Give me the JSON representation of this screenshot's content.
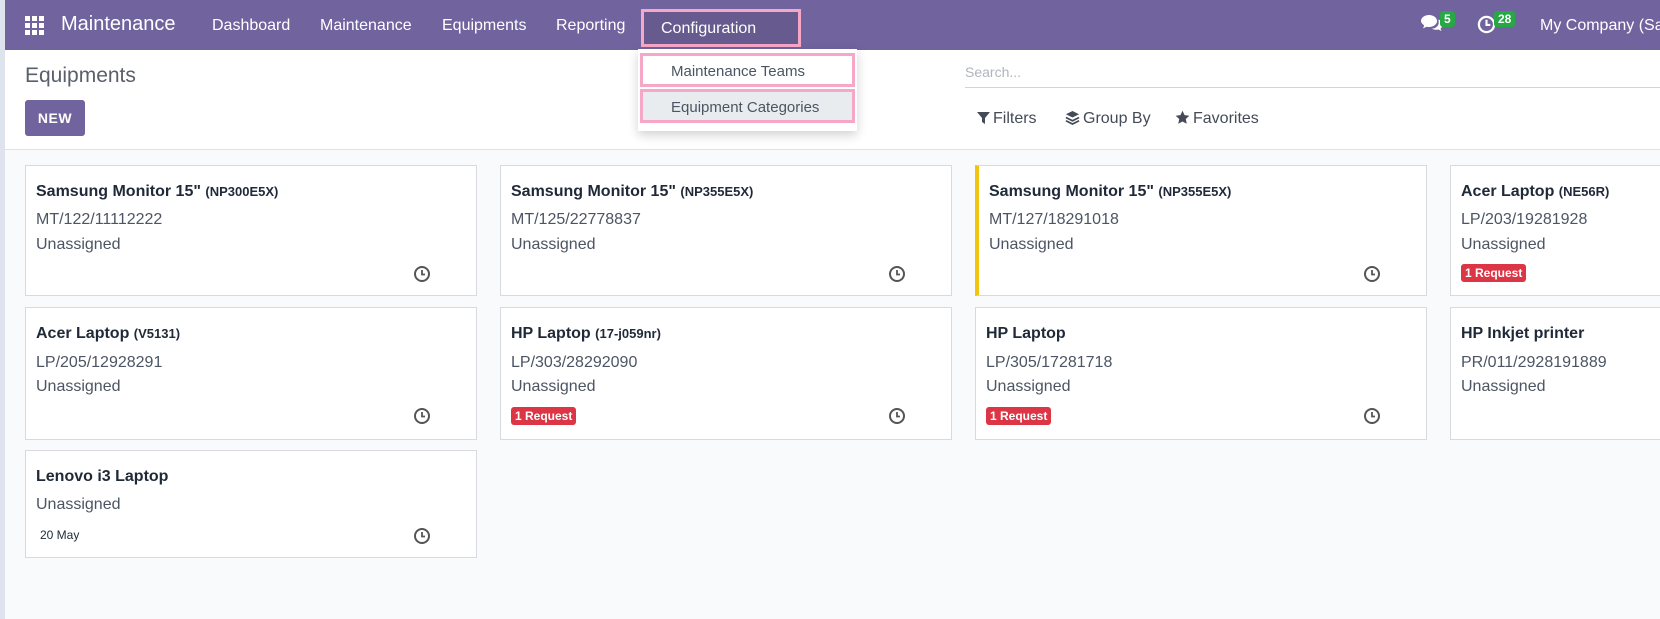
{
  "nav": {
    "brand": "Maintenance",
    "menu": [
      "Dashboard",
      "Maintenance",
      "Equipments",
      "Reporting",
      "Configuration"
    ],
    "messages_count": "5",
    "activities_count": "28",
    "company": "My Company (Sa"
  },
  "config_menu": {
    "items": [
      "Maintenance Teams",
      "Equipment Categories"
    ]
  },
  "control_panel": {
    "title": "Equipments",
    "new_label": "NEW",
    "search_placeholder": "Search...",
    "filters_label": "Filters",
    "groupby_label": "Group By",
    "favorites_label": "Favorites"
  },
  "cards": [
    {
      "name": "Samsung Monitor 15\"",
      "model": "(NP300E5X)",
      "serial": "MT/122/11112222",
      "assignee": "Unassigned",
      "badge": ""
    },
    {
      "name": "Samsung Monitor 15\"",
      "model": "(NP355E5X)",
      "serial": "MT/125/22778837",
      "assignee": "Unassigned",
      "badge": ""
    },
    {
      "name": "Samsung Monitor 15\"",
      "model": "(NP355E5X)",
      "serial": "MT/127/18291018",
      "assignee": "Unassigned",
      "badge": ""
    },
    {
      "name": "Acer Laptop",
      "model": "(NE56R)",
      "serial": "LP/203/19281928",
      "assignee": "Unassigned",
      "badge": "1 Request"
    },
    {
      "name": "Acer Laptop",
      "model": "(V5131)",
      "serial": "LP/205/12928291",
      "assignee": "Unassigned",
      "badge": ""
    },
    {
      "name": "HP Laptop",
      "model": "(17-j059nr)",
      "serial": "LP/303/28292090",
      "assignee": "Unassigned",
      "badge": "1 Request"
    },
    {
      "name": "HP Laptop",
      "model": "",
      "serial": "LP/305/17281718",
      "assignee": "Unassigned",
      "badge": "1 Request"
    },
    {
      "name": "HP Inkjet printer",
      "model": "",
      "serial": "PR/011/2928191889",
      "assignee": "Unassigned",
      "badge": ""
    },
    {
      "name": "Lenovo i3 Laptop",
      "model": "",
      "serial": "",
      "assignee": "Unassigned",
      "badge": "",
      "date": "20 May"
    }
  ],
  "colors": {
    "navbar": "#71639e",
    "highlight": "#f6a6c6",
    "badge_success": "#28a745",
    "badge_danger": "#dc3545",
    "card_accent": "#f1c40f"
  },
  "icons": [
    "apps-grid-icon",
    "chat-icon",
    "clock-icon",
    "filter-icon",
    "layers-icon",
    "star-icon",
    "activity-clock-icon"
  ]
}
